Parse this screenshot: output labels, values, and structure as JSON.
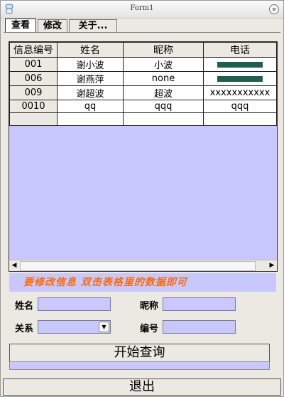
{
  "window": {
    "title": "Form1"
  },
  "tabs": [
    {
      "label": "查看",
      "active": true
    },
    {
      "label": "修改",
      "active": false
    },
    {
      "label": "关于...",
      "active": false
    }
  ],
  "table": {
    "headers": [
      "信息编号",
      "姓名",
      "昵称",
      "电话"
    ],
    "rows": [
      {
        "id": "001",
        "name": "谢小波",
        "nick": "小波",
        "phone": ""
      },
      {
        "id": "006",
        "name": "谢燕萍",
        "nick": "none",
        "phone": ""
      },
      {
        "id": "009",
        "name": "谢超波",
        "nick": "超波",
        "phone": "xxxxxxxxxxx"
      },
      {
        "id": "0010",
        "name": "qq",
        "nick": "qqq",
        "phone": "qqq"
      },
      {
        "id": "",
        "name": "",
        "nick": "",
        "phone": ""
      }
    ]
  },
  "hint": "要修改信息 双击表格里的数据即可",
  "form": {
    "name_label": "姓名",
    "nick_label": "昵称",
    "relation_label": "关系",
    "number_label": "编号",
    "name_value": "",
    "nick_value": "",
    "relation_value": "",
    "number_value": ""
  },
  "buttons": {
    "query": "开始查询",
    "exit": "退出"
  },
  "colors": {
    "accent": "#c8c8ff",
    "hint": "#ff6a00",
    "redaction": "#1f5f4f"
  }
}
